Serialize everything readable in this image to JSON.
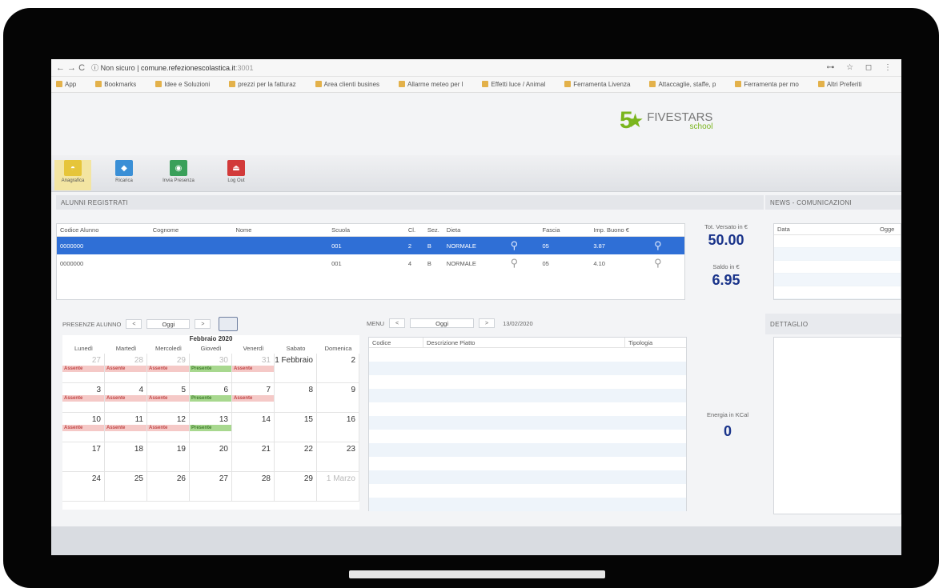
{
  "browser": {
    "nav_icons": "← → C",
    "security": "ⓘ Non sicuro",
    "url": "comune.refezionescolastica.it",
    "url_suffix": ":3001",
    "right_icons": "⊶ ☆ ◻ ⋮",
    "bookmarks": [
      "App",
      "Bookmarks",
      "Idee e Soluzioni",
      "prezzi per la fatturaz",
      "Area clienti busines",
      "Allarme meteo per l",
      "Effetti luce / Animal",
      "Ferramenta Livenza",
      "Attaccaglie, staffe, p",
      "Ferramenta per mo",
      "Altri Preferiti"
    ]
  },
  "logo": {
    "five": "5",
    "brand": "FIVESTARS",
    "sub": "school"
  },
  "toolbar": [
    {
      "label": "Anagrafica",
      "color": "#e6c53a",
      "icon": "person-icon"
    },
    {
      "label": "Ricarica",
      "color": "#3a8fd6",
      "icon": "wallet-icon"
    },
    {
      "label": "Invia Presenza",
      "color": "#3aa05a",
      "icon": "check-circle-icon"
    },
    {
      "label": "Log Out",
      "color": "#d23a3a",
      "icon": "logout-icon"
    }
  ],
  "students": {
    "section_title": "ALUNNI REGISTRATI",
    "columns": [
      "Codice Alunno",
      "Cognome",
      "Nome",
      "Scuola",
      "Cl.",
      "Sez.",
      "Dieta",
      "",
      "Fascia",
      "Imp. Buono €",
      ""
    ],
    "rows": [
      {
        "code": "0000000",
        "surname": "",
        "name": "",
        "school": "001",
        "cl": "2",
        "sez": "B",
        "diet": "NORMALE",
        "band": "05",
        "amount": "3.87",
        "selected": true
      },
      {
        "code": "0000000",
        "surname": "",
        "name": "",
        "school": "001",
        "cl": "4",
        "sez": "B",
        "diet": "NORMALE",
        "band": "05",
        "amount": "4.10",
        "selected": false
      }
    ]
  },
  "totals": {
    "paid_label": "Tot. Versato in €",
    "paid_value": "50.00",
    "balance_label": "Saldo in €",
    "balance_value": "6.95"
  },
  "news": {
    "section_title": "NEWS - COMUNICAZIONI",
    "col_date": "Data",
    "col_subject": "Ogge"
  },
  "presence": {
    "label": "PRESENZE ALUNNO",
    "prev": "<",
    "today": "Oggi",
    "next": ">"
  },
  "menu_ctrl": {
    "label": "MENU",
    "prev": "<",
    "today": "Oggi",
    "next": ">",
    "date": "13/02/2020"
  },
  "calendar": {
    "title": "Febbraio 2020",
    "weekdays": [
      "Lunedì",
      "Martedì",
      "Mercoledì",
      "Giovedì",
      "Venerdì",
      "Sabato",
      "Domenica"
    ],
    "weeks": [
      [
        {
          "n": "27",
          "m": true,
          "b": "Assente"
        },
        {
          "n": "28",
          "m": true,
          "b": "Assente"
        },
        {
          "n": "29",
          "m": true,
          "b": "Assente"
        },
        {
          "n": "30",
          "m": true,
          "b": "Presente",
          "ok": true
        },
        {
          "n": "31",
          "m": true,
          "b": "Assente"
        },
        {
          "n": "1 Febbraio"
        },
        {
          "n": "2"
        }
      ],
      [
        {
          "n": "3",
          "b": "Assente"
        },
        {
          "n": "4",
          "b": "Assente"
        },
        {
          "n": "5",
          "b": "Assente"
        },
        {
          "n": "6",
          "b": "Presente",
          "ok": true
        },
        {
          "n": "7",
          "b": "Assente"
        },
        {
          "n": "8"
        },
        {
          "n": "9"
        }
      ],
      [
        {
          "n": "10",
          "b": "Assente"
        },
        {
          "n": "11",
          "b": "Assente"
        },
        {
          "n": "12",
          "b": "Assente"
        },
        {
          "n": "13",
          "b": "Presente",
          "ok": true
        },
        {
          "n": "14"
        },
        {
          "n": "15"
        },
        {
          "n": "16"
        }
      ],
      [
        {
          "n": "17"
        },
        {
          "n": "18"
        },
        {
          "n": "19"
        },
        {
          "n": "20"
        },
        {
          "n": "21"
        },
        {
          "n": "22"
        },
        {
          "n": "23"
        }
      ],
      [
        {
          "n": "24"
        },
        {
          "n": "25"
        },
        {
          "n": "26"
        },
        {
          "n": "27"
        },
        {
          "n": "28"
        },
        {
          "n": "29"
        },
        {
          "n": "1 Marzo",
          "m": true
        }
      ]
    ]
  },
  "menu_table": {
    "columns": [
      "Codice",
      "Descrizione Piatto",
      "Tipologia"
    ]
  },
  "energy": {
    "label": "Energia in KCal",
    "value": "0"
  },
  "notes": {
    "title": "DETTAGLIO"
  }
}
